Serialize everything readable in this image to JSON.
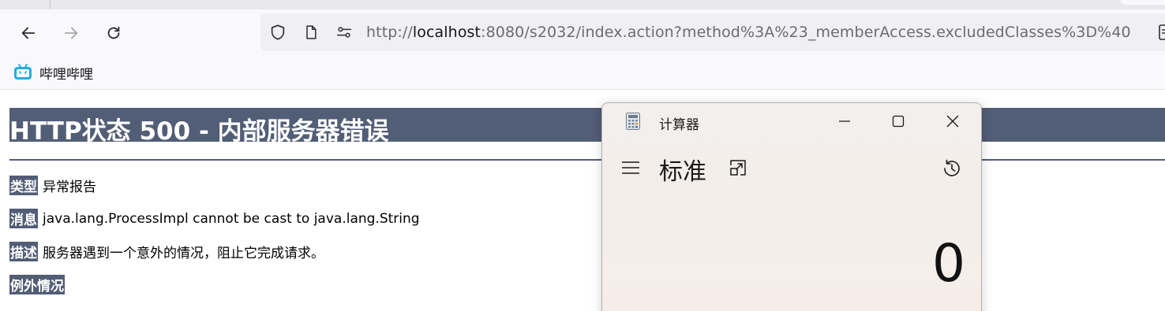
{
  "browser": {
    "url_scheme": "http://",
    "url_host": "localhost",
    "url_rest": ":8080/s2032/index.action?method%3A%23_memberAccess.excludedClasses%3D%40",
    "bookmark_label": "哔哩哔哩"
  },
  "page": {
    "title": "HTTP状态 500 - 内部服务器错误",
    "rows": [
      {
        "label": "类型",
        "value": "异常报告"
      },
      {
        "label": "消息",
        "value": "java.lang.ProcessImpl cannot be cast to java.lang.String"
      },
      {
        "label": "描述",
        "value": "服务器遇到一个意外的情况，阻止它完成请求。"
      },
      {
        "label": "例外情况",
        "value": ""
      }
    ]
  },
  "calculator": {
    "window_title": "计算器",
    "mode": "标准",
    "display_value": "0"
  },
  "colors": {
    "error_header": "#525d76",
    "toolbar": "#f9f9fb",
    "urlbar": "#f0f0f4",
    "bilibili_blue": "#23ade5"
  }
}
